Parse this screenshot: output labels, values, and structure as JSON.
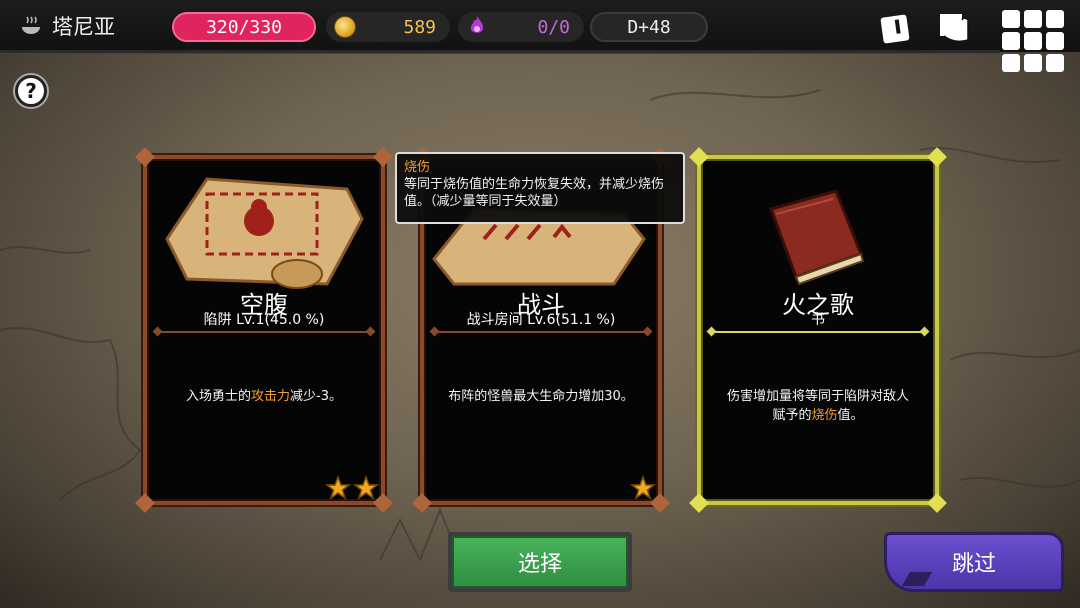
{
  "header": {
    "location_icon": "cauldron-icon",
    "location_name": "塔尼亚",
    "hp": "320/330",
    "hp_color": "#e0245e",
    "gold_icon": "coin-stack-icon",
    "gold": "589",
    "soul_icon": "purple-flame-icon",
    "souls": "0/0",
    "day": "D+48",
    "buttons": [
      "card-deck-icon",
      "map-scroll-icon",
      "grid-menu-icon"
    ]
  },
  "help": {
    "label": "?"
  },
  "cards": [
    {
      "icon": "trap-scroll-icon",
      "title": "空腹",
      "subtitle": "陷阱 Lv.1(45.0 %)",
      "desc_pre": "入场勇士的",
      "desc_hl": "攻击力",
      "desc_post": "减少-3。",
      "stars": 2,
      "frame": "bronze"
    },
    {
      "icon": "battle-scroll-icon",
      "title": "战斗",
      "subtitle": "战斗房间 Lv.6(51.1 %)",
      "desc": "布阵的怪兽最大生命力增加30。",
      "stars": 1,
      "frame": "bronze"
    },
    {
      "icon": "red-book-icon",
      "title": "火之歌",
      "subtitle": "书",
      "desc_line1": "伤害增加量将等同于陷阱对敌人",
      "desc_pre": "赋予的",
      "desc_hl": "烧伤",
      "desc_post": "值。",
      "stars": 0,
      "frame": "gold"
    }
  ],
  "tooltip": {
    "title": "烧伤",
    "body": "等同于烧伤值的生命力恢复失效，并减少烧伤值。（减少量等同于失效量）"
  },
  "actions": {
    "select_label": "选择",
    "skip_label": "跳过"
  },
  "colors": {
    "highlight": "#f2a12e",
    "select_button": "#3a9f4e",
    "skip_button": "#5c42bf",
    "gold_text": "#f2c14e",
    "soul_text": "#c06ad8"
  }
}
